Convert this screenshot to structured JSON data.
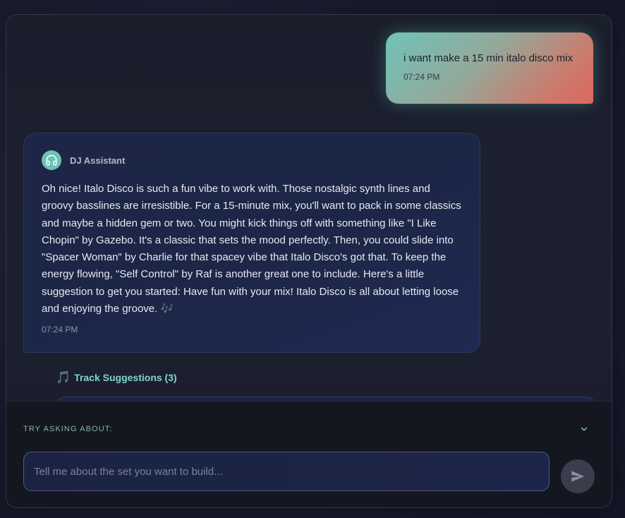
{
  "user_message": {
    "text": "i want make a 15 min italo disco mix",
    "time": "07:24 PM"
  },
  "assistant_message": {
    "sender": "DJ Assistant",
    "avatar_icon": "headphones-icon",
    "text": "Oh nice! Italo Disco is such a fun vibe to work with. Those nostalgic synth lines and groovy basslines are irresistible. For a 15-minute mix, you'll want to pack in some classics and maybe a hidden gem or two. You might kick things off with something like \"I Like Chopin\" by Gazebo. It's a classic that sets the mood perfectly. Then, you could slide into \"Spacer Woman\" by Charlie for that spacey vibe that Italo Disco's got that. To keep the energy flowing, \"Self Control\" by Raf is another great one to include. Here's a little suggestion to get you started: Have fun with your mix! Italo Disco is all about letting loose and enjoying the groove. 🎶",
    "time": "07:24 PM"
  },
  "track_suggestions": {
    "icon": "music-note-icon",
    "note_glyph": "🎵",
    "label": "Track Suggestions (3)"
  },
  "prompt_panel": {
    "try_asking_label": "TRY ASKING ABOUT:",
    "toggle_icon": "chevron-down-icon"
  },
  "composer": {
    "placeholder": "Tell me about the set you want to build...",
    "value": "",
    "send_icon": "send-icon"
  },
  "colors": {
    "accent": "#6cc3b6",
    "user_bubble_start": "#6fc3b9",
    "user_bubble_end": "#d9695d",
    "assistant_bubble": "#1d2646"
  }
}
